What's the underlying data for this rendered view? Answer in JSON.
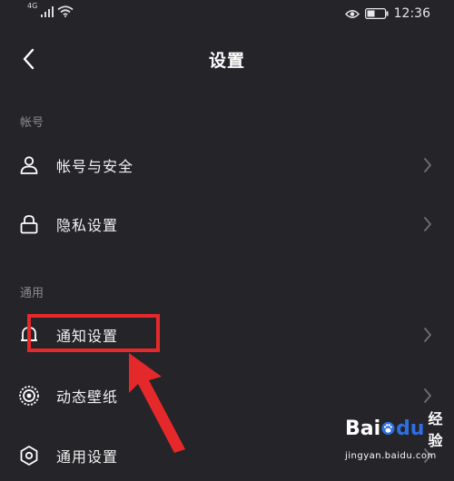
{
  "status_bar": {
    "signal_label": "4G",
    "time": "12:36"
  },
  "nav": {
    "title": "设置"
  },
  "sections": [
    {
      "header": "帐号",
      "items": [
        {
          "label": "帐号与安全",
          "icon": "person-icon"
        },
        {
          "label": "隐私设置",
          "icon": "lock-icon"
        }
      ]
    },
    {
      "header": "通用",
      "items": [
        {
          "label": "通知设置",
          "icon": "bell-icon"
        },
        {
          "label": "动态壁纸",
          "icon": "live-wallpaper-icon"
        },
        {
          "label": "通用设置",
          "icon": "gear-icon"
        }
      ]
    }
  ],
  "annotation": {
    "highlight_color": "#e5292b"
  },
  "watermark": {
    "bai": "Bai",
    "du": "du",
    "jingyan": "经验",
    "url": "jingyan.baidu.com"
  }
}
